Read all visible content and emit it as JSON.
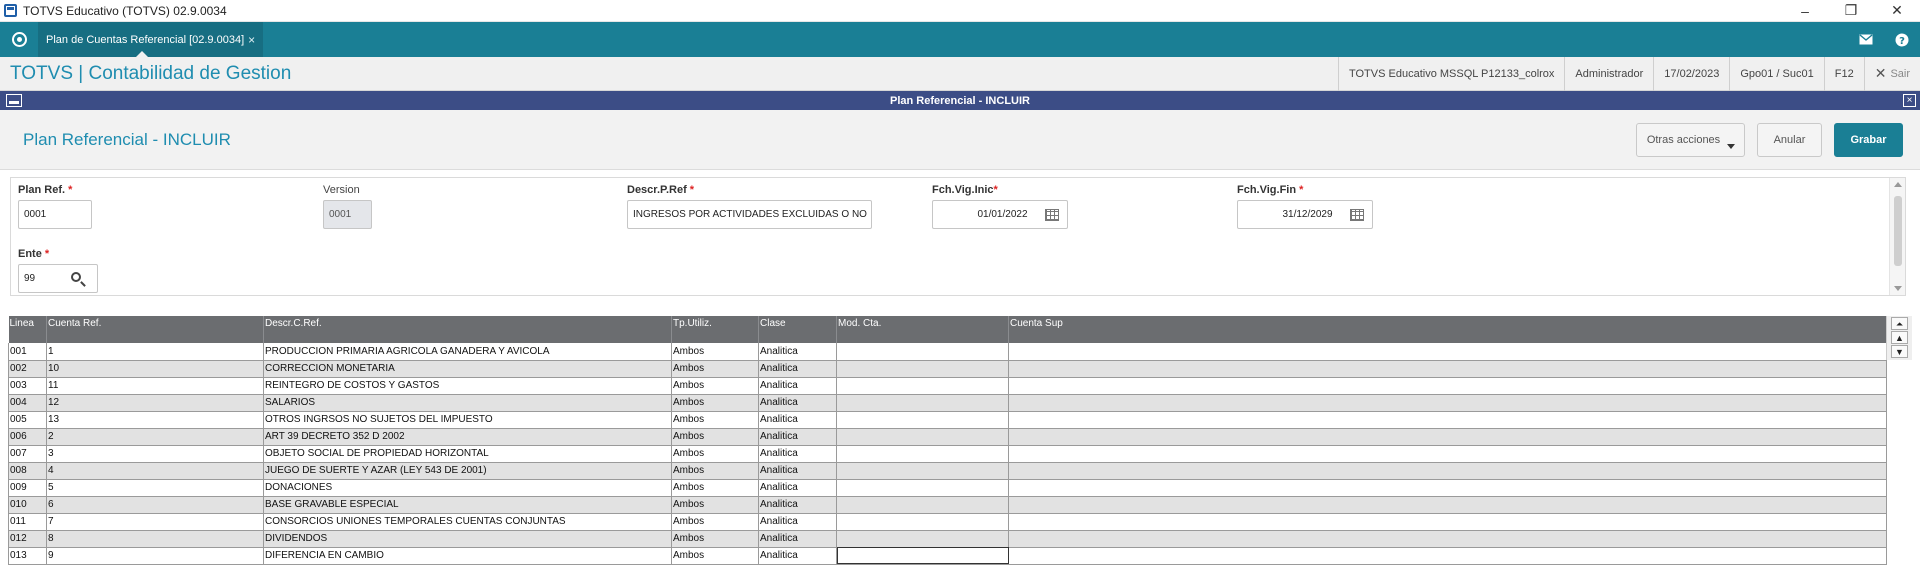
{
  "window": {
    "title": "TOTVS Educativo (TOTVS) 02.9.0034",
    "minimize": "–",
    "restore": "❐",
    "close": "✕"
  },
  "tabs": [
    {
      "label": "Plan de Cuentas Referencial [02.9.0034]",
      "close": "×"
    }
  ],
  "header": {
    "brand": "TOTVS | Contabilidad de Gestion",
    "environment": "TOTVS Educativo MSSQL P12133_colrox",
    "user": "Administrador",
    "date": "17/02/2023",
    "branch": "Gpo01 / Suc01",
    "help_key": "F12",
    "exit_label": "Sair"
  },
  "dialog": {
    "title": "Plan Referencial - INCLUIR",
    "close": "×"
  },
  "page": {
    "title": "Plan Referencial - INCLUIR",
    "buttons": {
      "other_actions": "Otras acciones",
      "cancel": "Anular",
      "save": "Grabar"
    }
  },
  "form": {
    "plan_ref": {
      "label": "Plan Ref.",
      "required": "*",
      "value": "0001"
    },
    "version": {
      "label": "Version",
      "value": "0001"
    },
    "descr": {
      "label": "Descr.P.Ref",
      "required": "*",
      "value": "INGRESOS POR ACTIVIDADES EXCLUIDAS O NO"
    },
    "fch_inic": {
      "label": "Fch.Vig.Inic",
      "required": "*",
      "value": "01/01/2022"
    },
    "fch_fin": {
      "label": "Fch.Vig.Fin",
      "required": "*",
      "value": "31/12/2029"
    },
    "ente": {
      "label": "Ente",
      "required": "*",
      "value": "99"
    }
  },
  "grid": {
    "columns": [
      "Linea",
      "Cuenta Ref.",
      "Descr.C.Ref.",
      "Tp.Utiliz.",
      "Clase",
      "Mod. Cta.",
      "Cuenta Sup"
    ],
    "rows": [
      [
        "001",
        "1",
        "PRODUCCION PRIMARIA AGRICOLA GANADERA Y AVICOLA",
        "Ambos",
        "Analitica",
        "",
        ""
      ],
      [
        "002",
        "10",
        "CORRECCION MONETARIA",
        "Ambos",
        "Analitica",
        "",
        ""
      ],
      [
        "003",
        "11",
        "REINTEGRO DE COSTOS Y GASTOS",
        "Ambos",
        "Analitica",
        "",
        ""
      ],
      [
        "004",
        "12",
        "SALARIOS",
        "Ambos",
        "Analitica",
        "",
        ""
      ],
      [
        "005",
        "13",
        "OTROS INGRSOS NO SUJETOS DEL IMPUESTO",
        "Ambos",
        "Analitica",
        "",
        ""
      ],
      [
        "006",
        "2",
        "ART 39 DECRETO 352 D 2002",
        "Ambos",
        "Analitica",
        "",
        ""
      ],
      [
        "007",
        "3",
        "OBJETO SOCIAL DE PROPIEDAD HORIZONTAL",
        "Ambos",
        "Analitica",
        "",
        ""
      ],
      [
        "008",
        "4",
        "JUEGO DE SUERTE Y AZAR (LEY 543 DE 2001)",
        "Ambos",
        "Analitica",
        "",
        ""
      ],
      [
        "009",
        "5",
        "DONACIONES",
        "Ambos",
        "Analitica",
        "",
        ""
      ],
      [
        "010",
        "6",
        "BASE GRAVABLE ESPECIAL",
        "Ambos",
        "Analitica",
        "",
        ""
      ],
      [
        "011",
        "7",
        "CONSORCIOS UNIONES TEMPORALES CUENTAS CONJUNTAS",
        "Ambos",
        "Analitica",
        "",
        ""
      ],
      [
        "012",
        "8",
        "DIVIDENDOS",
        "Ambos",
        "Analitica",
        "",
        ""
      ],
      [
        "013",
        "9",
        "DIFERENCIA EN CAMBIO",
        "Ambos",
        "Analitica",
        "",
        ""
      ]
    ]
  },
  "colors": {
    "tabbar": "#1a7f95",
    "dialog_header": "#3c4d86",
    "brand_text": "#1f8db0",
    "grid_header": "#6b6d70"
  }
}
